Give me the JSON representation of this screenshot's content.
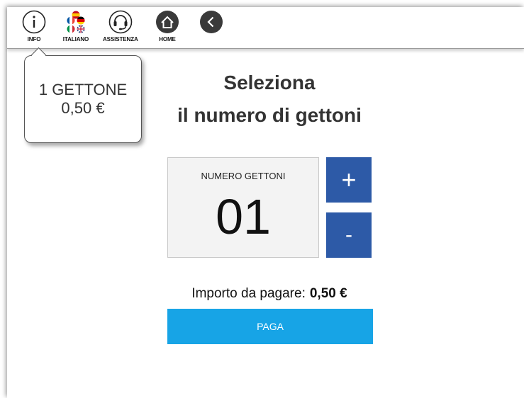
{
  "topbar": {
    "info_label": "INFO",
    "language_label": "ITALIANO",
    "assistance_label": "ASSISTENZA",
    "home_label": "HOME",
    "back_icon": "chevron-left-icon"
  },
  "tooltip": {
    "line1": "1 GETTONE",
    "line2": "0,50 €"
  },
  "title": {
    "line1": "Seleziona",
    "line2": "il numero di gettoni"
  },
  "counter": {
    "label": "NUMERO GETTONI",
    "value": "01",
    "plus_label": "+",
    "minus_label": "-"
  },
  "payment": {
    "amount_label": "Importo da pagare:",
    "amount_value": "0,50 €",
    "pay_label": "PAGA"
  },
  "colors": {
    "stepper_blue": "#2d5aa7",
    "pay_blue": "#17a4e6",
    "dark_icon": "#3a3a3a"
  }
}
